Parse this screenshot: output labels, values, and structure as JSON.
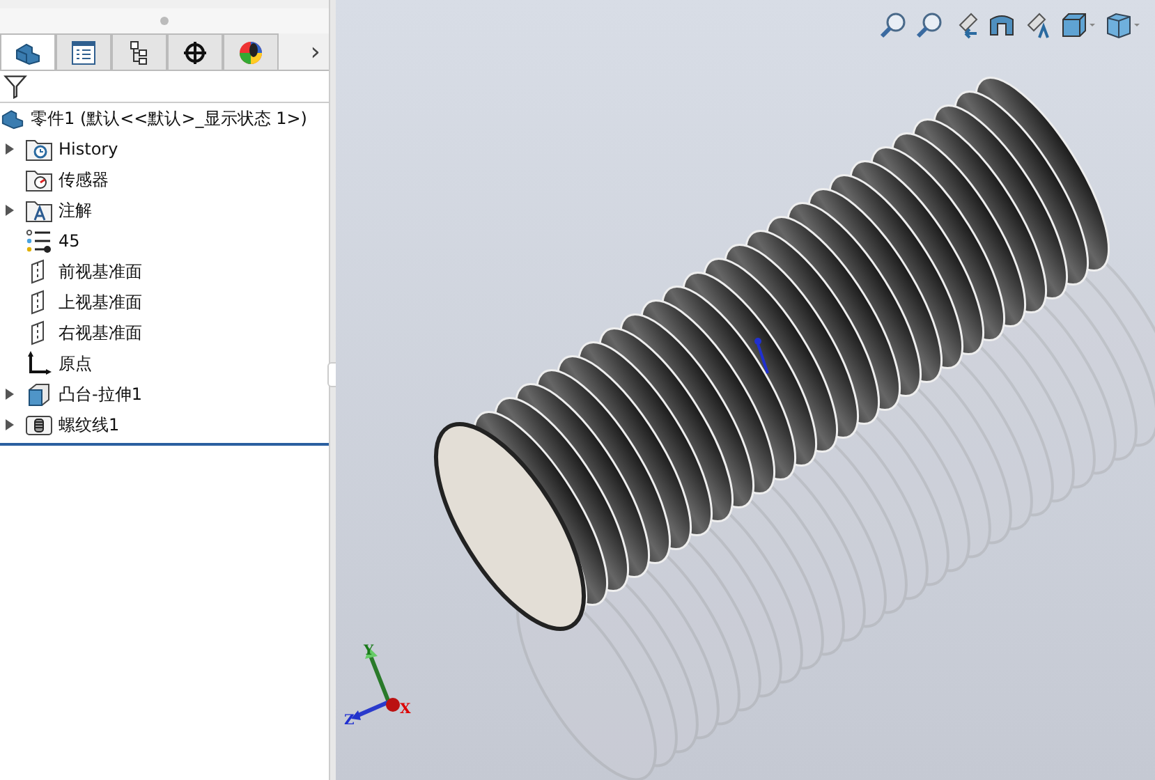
{
  "panel": {
    "tabs": [
      {
        "selected": true
      },
      {
        "selected": false
      },
      {
        "selected": false
      },
      {
        "selected": false
      },
      {
        "selected": false
      }
    ],
    "more": "›",
    "root": {
      "label": "零件1  (默认<<默认>_显示状态 1>)"
    },
    "tree": [
      {
        "label": "History",
        "kind": "history",
        "expanded": false
      },
      {
        "label": "传感器",
        "kind": "sensor"
      },
      {
        "label": "注解",
        "kind": "annotation",
        "expanded": false
      },
      {
        "label": "45",
        "kind": "material"
      },
      {
        "label": "前视基准面",
        "kind": "plane"
      },
      {
        "label": "上视基准面",
        "kind": "plane"
      },
      {
        "label": "右视基准面",
        "kind": "plane"
      },
      {
        "label": "原点",
        "kind": "origin"
      },
      {
        "label": "凸台-拉伸1",
        "kind": "extrude",
        "expanded": false
      },
      {
        "label": "螺纹线1",
        "kind": "thread",
        "expanded": false
      }
    ]
  },
  "viewport": {
    "triad": {
      "x": "X",
      "y": "Y",
      "z": "Z"
    }
  }
}
